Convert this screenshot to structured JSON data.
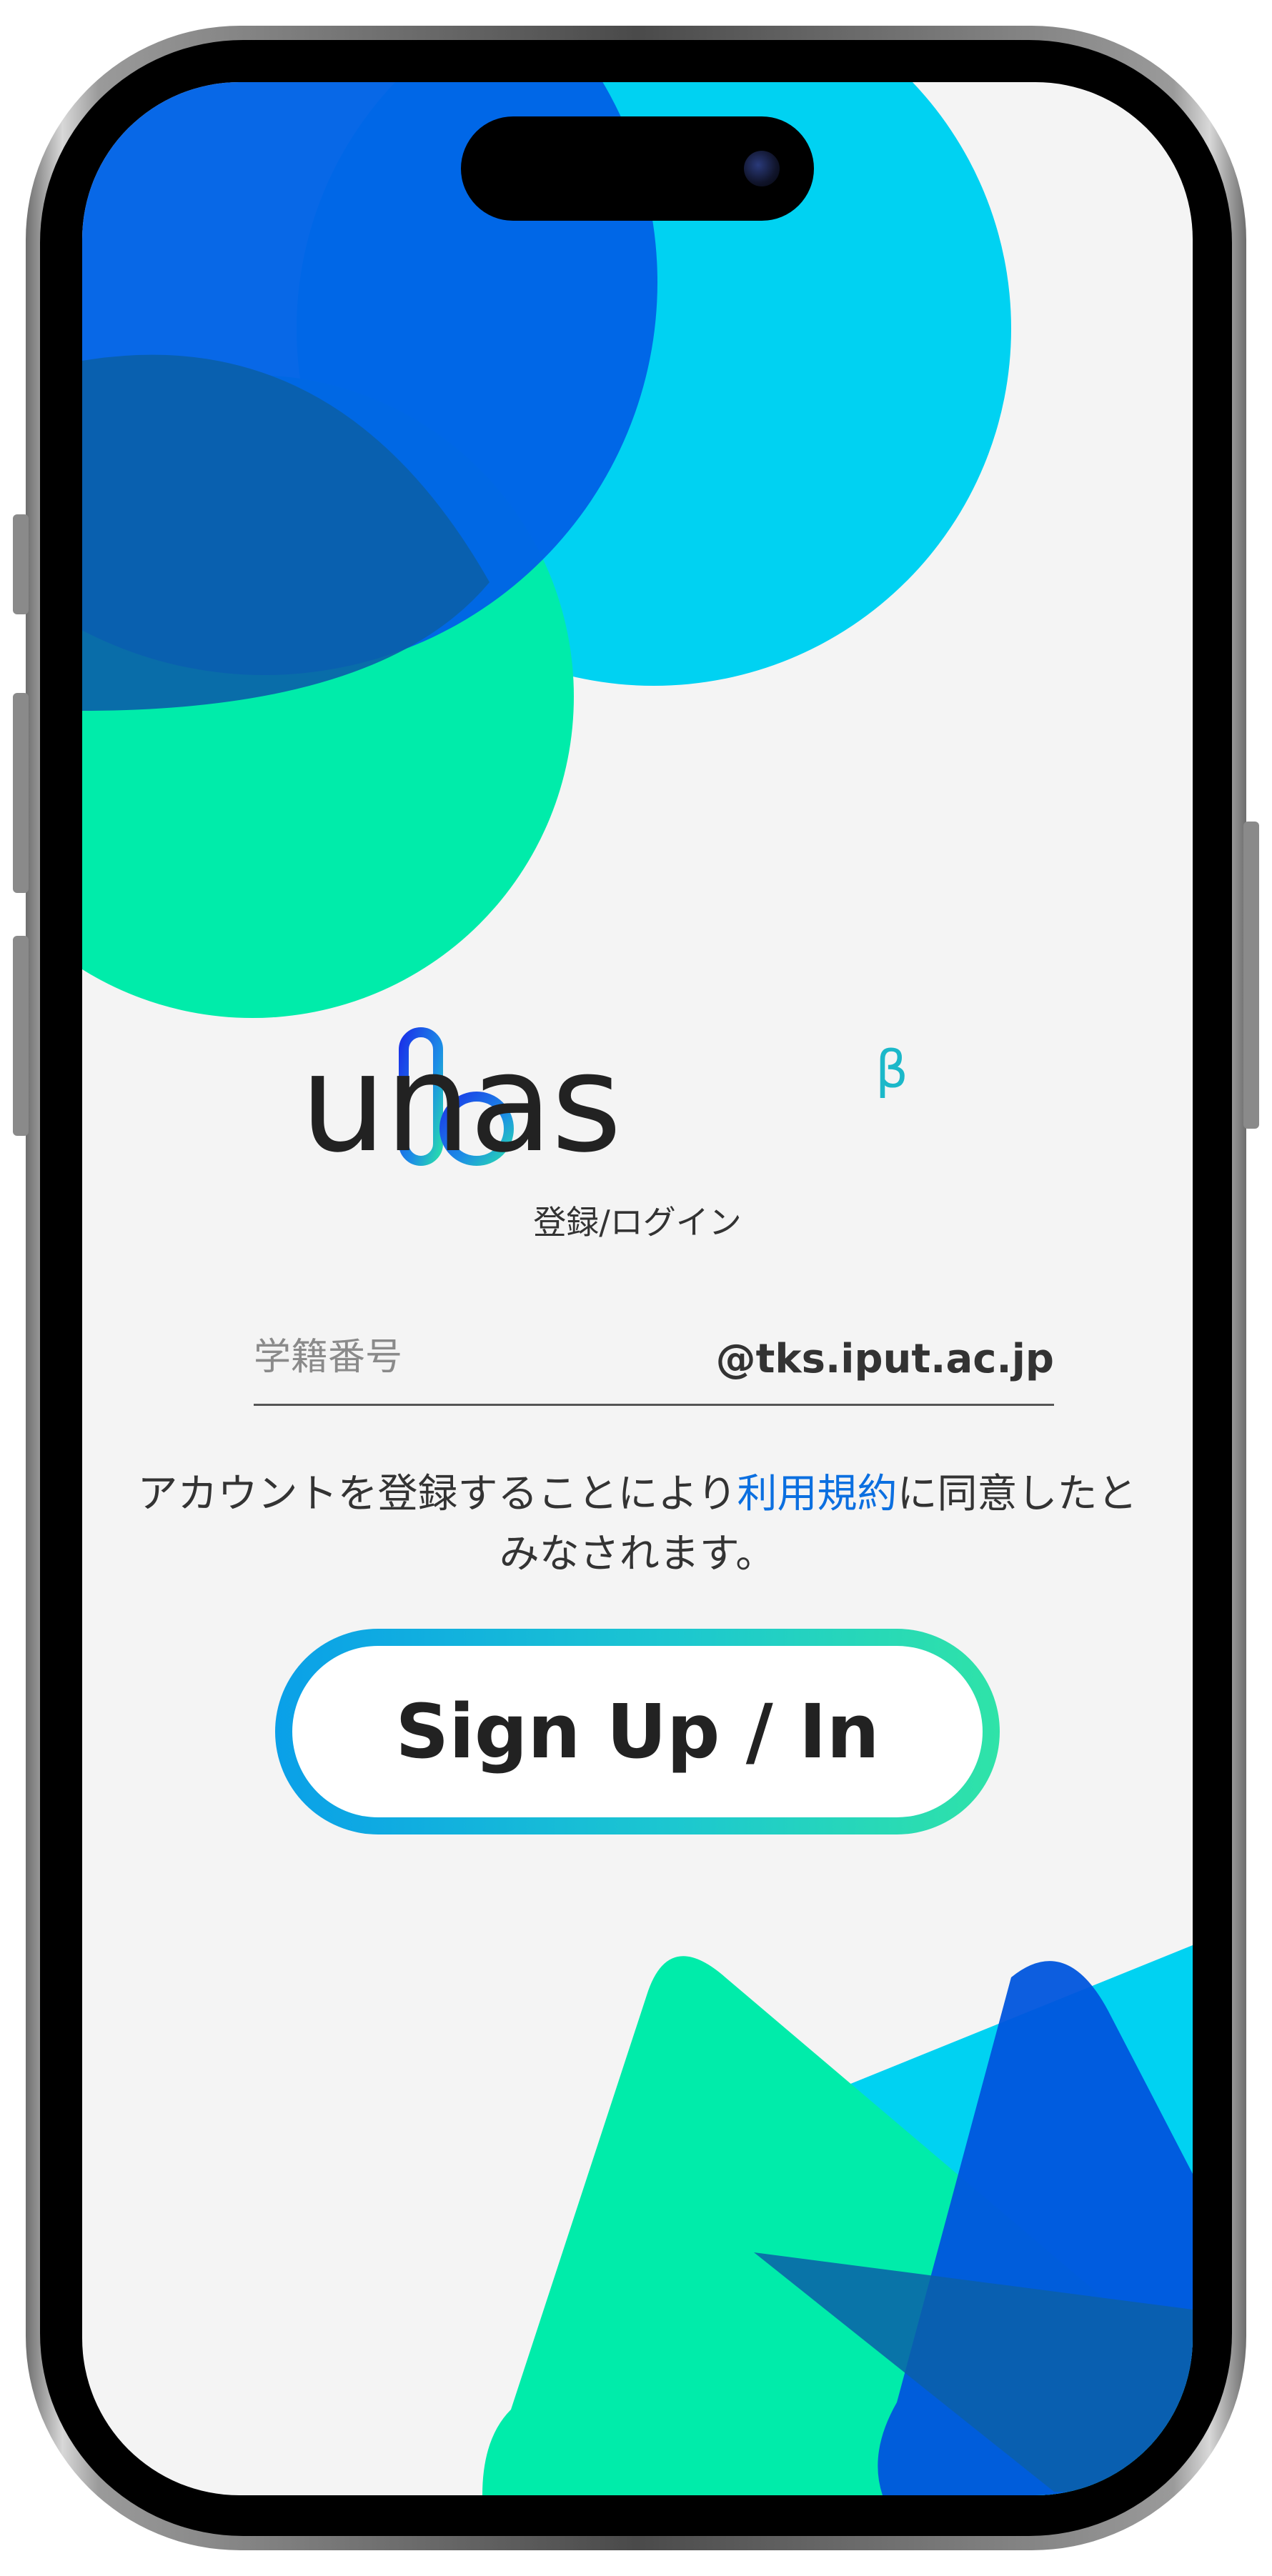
{
  "app": {
    "name": "unas",
    "beta_mark": "β",
    "subtitle": "登録/ログイン"
  },
  "student_id_field": {
    "placeholder": "学籍番号",
    "value": "",
    "domain_suffix": "@tks.iput.ac.jp"
  },
  "terms_notice": {
    "prefix": "アカウントを登録することにより",
    "link_label": "利用規約",
    "suffix": "に同意したとみなされます。"
  },
  "signup_button": {
    "label": "Sign Up / In"
  },
  "colors": {
    "blue": "#0063e6",
    "cyan": "#00d2f2",
    "green": "#00ecaa",
    "dark_blue": "#0a5fa8",
    "link": "#0b6fe0",
    "background": "#f4f4f4"
  }
}
